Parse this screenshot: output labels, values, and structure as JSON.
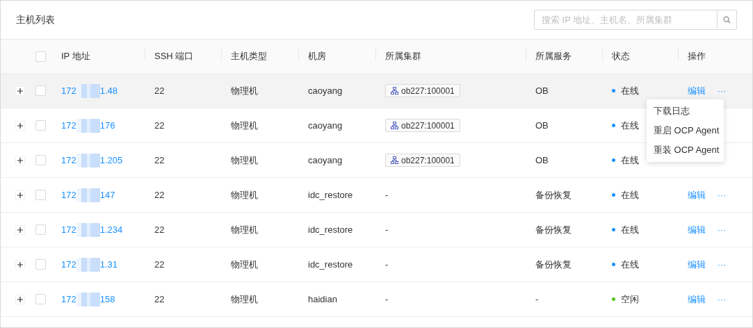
{
  "title": "主机列表",
  "search": {
    "placeholder": "搜索 IP 地址、主机名、所属集群"
  },
  "table": {
    "header_checkbox": {
      "checked": false
    },
    "columns": [
      "IP 地址",
      "SSH 端口",
      "主机类型",
      "机房",
      "所属集群",
      "所属服务",
      "状态",
      "操作"
    ],
    "rows": [
      {
        "expanded": false,
        "checked": false,
        "hovered": true,
        "ip_start": "172",
        "ip_end": "1.48",
        "port": "22",
        "type": "物理机",
        "room": "caoyang",
        "cluster": {
          "kind": "tag",
          "text": "ob227:100001"
        },
        "service": "OB",
        "status": {
          "text": "在线",
          "color": "#1890ff"
        },
        "edit": "编辑",
        "more": "···"
      },
      {
        "expanded": false,
        "checked": false,
        "hovered": false,
        "ip_start": "172",
        "ip_end": "176",
        "port": "22",
        "type": "物理机",
        "room": "caoyang",
        "cluster": {
          "kind": "tag",
          "text": "ob227:100001"
        },
        "service": "OB",
        "status": {
          "text": "在线",
          "color": "#1890ff"
        }
      },
      {
        "expanded": false,
        "checked": false,
        "hovered": false,
        "ip_start": "172",
        "ip_end": "1.205",
        "port": "22",
        "type": "物理机",
        "room": "caoyang",
        "cluster": {
          "kind": "tag",
          "text": "ob227:100001"
        },
        "service": "OB",
        "status": {
          "text": "在线",
          "color": "#1890ff"
        }
      },
      {
        "expanded": false,
        "checked": false,
        "hovered": false,
        "ip_start": "172",
        "ip_end": "147",
        "port": "22",
        "type": "物理机",
        "room": "idc_restore",
        "cluster": {
          "kind": "text",
          "text": "-"
        },
        "service": "备份恢复",
        "status": {
          "text": "在线",
          "color": "#1890ff"
        },
        "edit": "编辑",
        "more": "···"
      },
      {
        "expanded": false,
        "checked": false,
        "hovered": false,
        "ip_start": "172",
        "ip_end": "1.234",
        "port": "22",
        "type": "物理机",
        "room": "idc_restore",
        "cluster": {
          "kind": "text",
          "text": "-"
        },
        "service": "备份恢复",
        "status": {
          "text": "在线",
          "color": "#1890ff"
        },
        "edit": "编辑",
        "more": "···"
      },
      {
        "expanded": false,
        "checked": false,
        "hovered": false,
        "ip_start": "172",
        "ip_end": "1.31",
        "port": "22",
        "type": "物理机",
        "room": "idc_restore",
        "cluster": {
          "kind": "text",
          "text": "-"
        },
        "service": "备份恢复",
        "status": {
          "text": "在线",
          "color": "#1890ff"
        },
        "edit": "编辑",
        "more": "···"
      },
      {
        "expanded": false,
        "checked": false,
        "hovered": false,
        "ip_start": "172",
        "ip_end": "158",
        "port": "22",
        "type": "物理机",
        "room": "haidian",
        "cluster": {
          "kind": "text",
          "text": "-"
        },
        "service": "-",
        "status": {
          "text": "空闲",
          "color": "#52c41a"
        },
        "edit": "编辑",
        "more": "···"
      }
    ]
  },
  "menu": {
    "items": [
      "下载日志",
      "重启 OCP Agent",
      "重装 OCP Agent"
    ]
  }
}
